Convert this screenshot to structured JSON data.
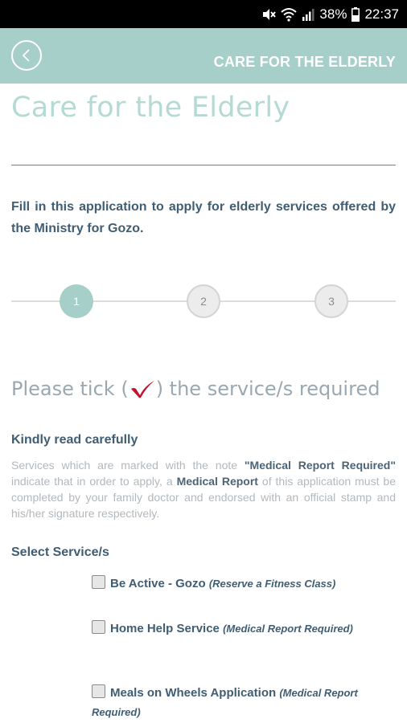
{
  "status_bar": {
    "battery": "38%",
    "time": "22:37",
    "icons": [
      "mute-icon",
      "wifi-icon",
      "signal-icon",
      "battery-icon"
    ]
  },
  "header": {
    "title": "CARE FOR THE ELDERLY",
    "back_icon": "chevron-left-icon",
    "background_color": "#a5cfc8"
  },
  "page": {
    "title": "Care for the Elderly",
    "intro": "Fill in this application to apply for elderly services offered by the Ministry for Gozo."
  },
  "stepper": {
    "steps": [
      "1",
      "2",
      "3"
    ],
    "active_step": 1
  },
  "tick_heading": {
    "before": "Please tick (",
    "icon": "checkmark-icon",
    "after": ") the service/s required"
  },
  "notice": {
    "heading": "Kindly read carefully",
    "text_1": "Services which are marked with the note ",
    "bold_1": "\"Medical Report Required\"",
    "text_2": " indicate that in order to apply, a ",
    "bold_2": "Medical Report",
    "text_3": " of this application must be completed by your family doctor and endorsed with an official stamp and his/her signature respectively."
  },
  "services": {
    "heading": "Select Service/s",
    "items": [
      {
        "name": "Be Active - Gozo",
        "note": "(Reserve a Fitness Class)",
        "checked": false
      },
      {
        "name": "Home Help Service",
        "note": "(Medical Report Required)",
        "checked": false
      },
      {
        "name": "Meals on Wheels Application",
        "note": "(Medical Report Required)",
        "checked": false
      }
    ]
  }
}
